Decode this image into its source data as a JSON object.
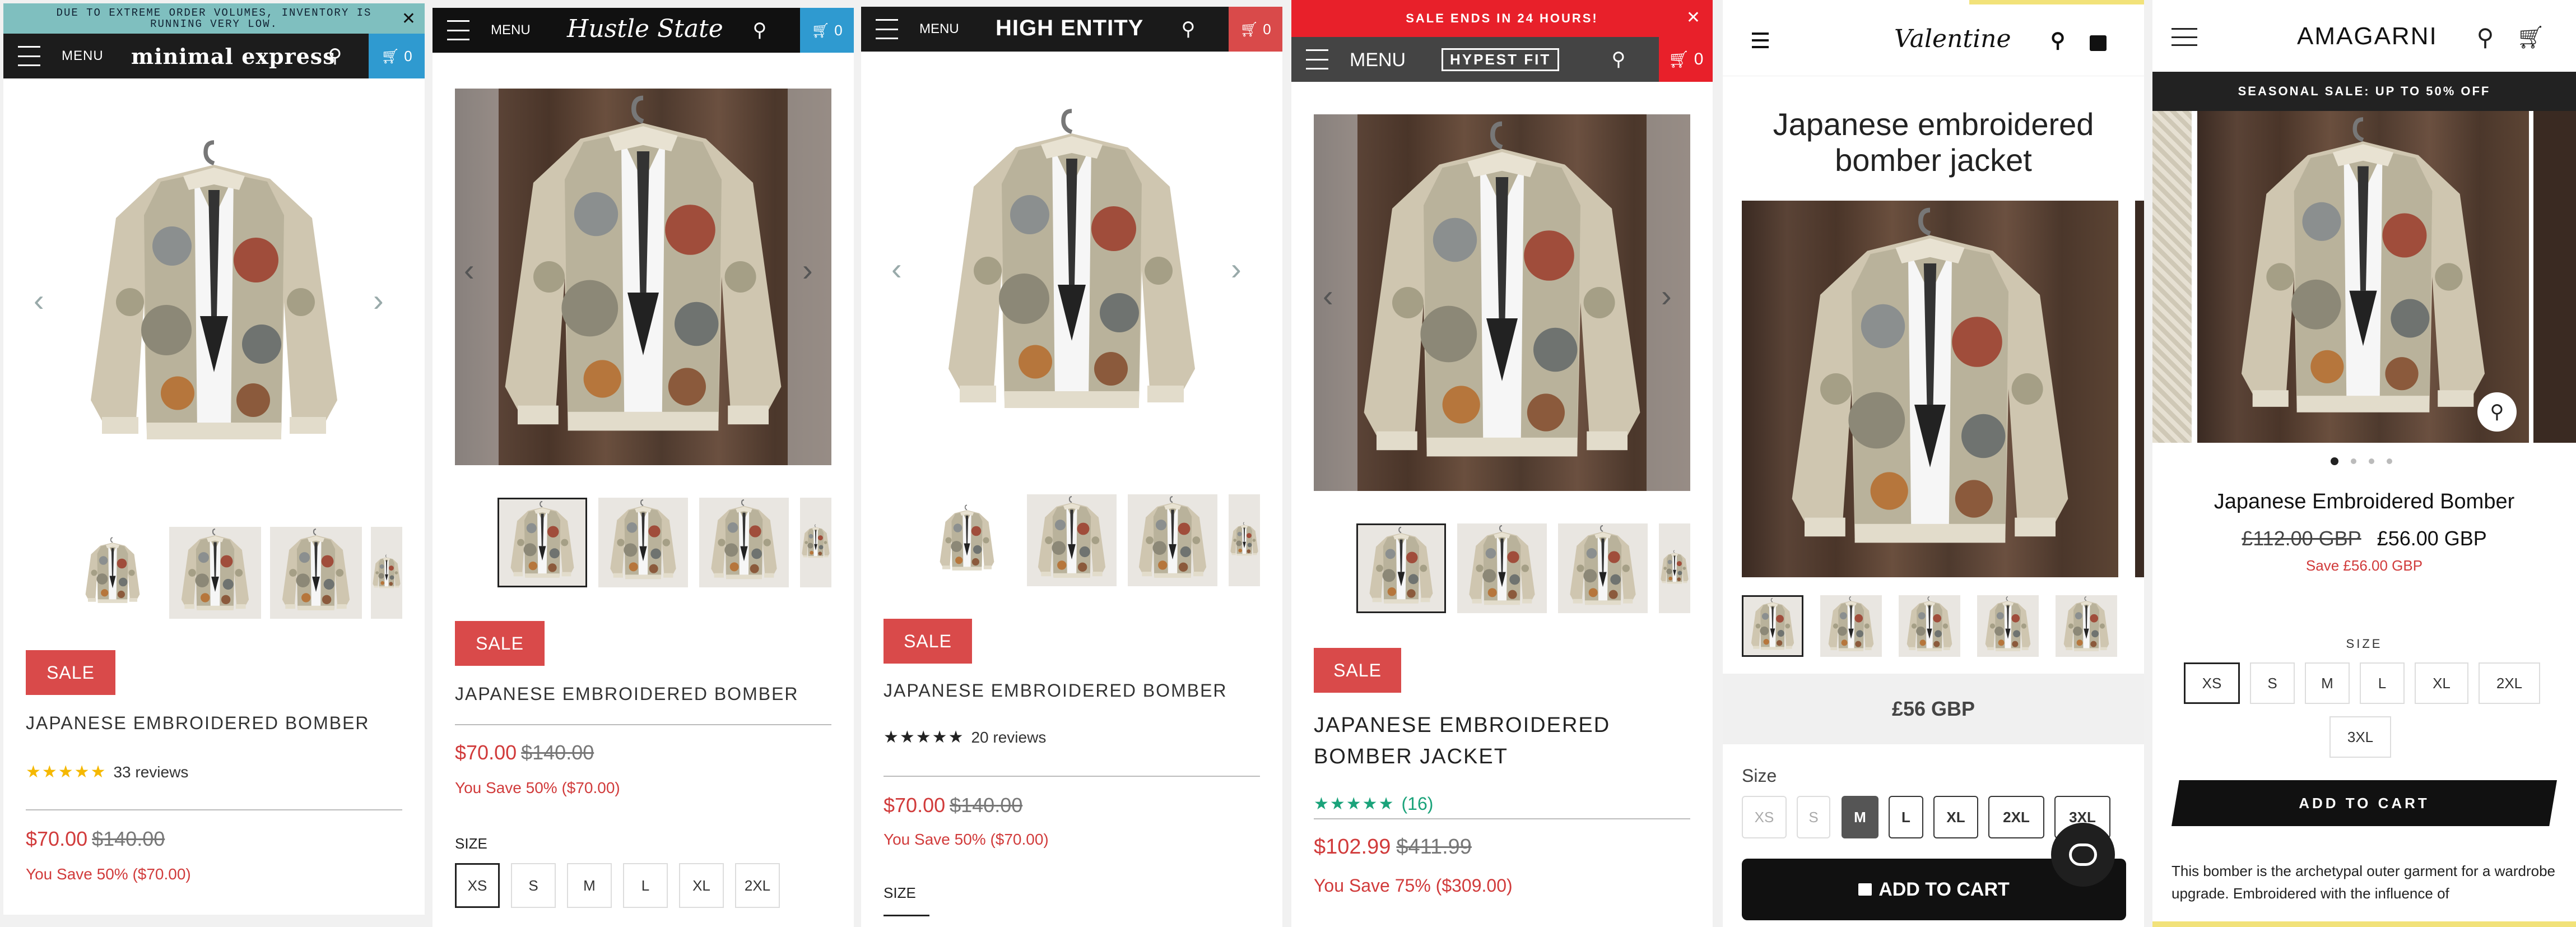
{
  "panels": [
    {
      "announcement": "DUE TO EXTREME ORDER VOLUMES, INVENTORY IS RUNNING VERY LOW.",
      "menu": "MENU",
      "brand": "minimal express",
      "cart_count": "0",
      "sale": "SALE",
      "title": "JAPANESE EMBROIDERED BOMBER",
      "stars": "★★★★★",
      "reviews": "33 reviews",
      "price": "$70.00",
      "compare": "$140.00",
      "save": "You Save 50% ($70.00)"
    },
    {
      "menu": "MENU",
      "brand": "Hustle State",
      "cart_count": "0",
      "sale": "SALE",
      "title": "JAPANESE EMBROIDERED BOMBER",
      "price": "$70.00",
      "compare": "$140.00",
      "save": "You Save 50% ($70.00)",
      "size_label": "SIZE",
      "sizes": [
        "XS",
        "S",
        "M",
        "L",
        "XL",
        "2XL"
      ]
    },
    {
      "menu": "MENU",
      "brand": "HIGH ENTITY",
      "cart_count": "0",
      "sale": "SALE",
      "title": "JAPANESE EMBROIDERED BOMBER",
      "stars": "★★★★★",
      "reviews": "20 reviews",
      "price": "$70.00",
      "compare": "$140.00",
      "save": "You Save 50% ($70.00)",
      "size_label": "SIZE"
    },
    {
      "announcement": "SALE ENDS IN 24 HOURS!",
      "menu": "MENU",
      "brand": "HYPEST FIT",
      "cart_count": "0",
      "sale": "SALE",
      "title": "JAPANESE EMBROIDERED BOMBER JACKET",
      "stars": "★★★★★",
      "reviews": "(16)",
      "price": "$102.99",
      "compare": "$411.99",
      "save": "You Save 75% ($309.00)"
    },
    {
      "brand": "Valentine",
      "title": "Japanese embroidered bomber jacket",
      "price": "£56 GBP",
      "size_label": "Size",
      "sizes": [
        "XS",
        "S",
        "M",
        "L",
        "XL",
        "2XL",
        "3XL"
      ],
      "selected_size": "M",
      "add_to_cart": "ADD TO CART"
    },
    {
      "brand": "AMAGARNI",
      "announcement": "SEASONAL SALE: UP TO 50% OFF",
      "title": "Japanese Embroidered Bomber",
      "compare": "£112.00 GBP",
      "price": "£56.00 GBP",
      "save": "Save £56.00 GBP",
      "size_label": "SIZE",
      "sizes": [
        "XS",
        "S",
        "M",
        "L",
        "XL",
        "2XL",
        "3XL"
      ],
      "add_to_cart": "ADD TO CART",
      "description": "This bomber is the archetypal outer garment for a wardrobe upgrade. Embroidered with the influence of"
    }
  ],
  "colors": {
    "sale_red": "#d94a4a",
    "teal": "#7fbfbf",
    "cart_blue": "#2f9ad0",
    "hype_red": "#e8202a",
    "dark": "#1a1a1a",
    "gold": "#f5b800",
    "green_star": "#1aa37a"
  }
}
